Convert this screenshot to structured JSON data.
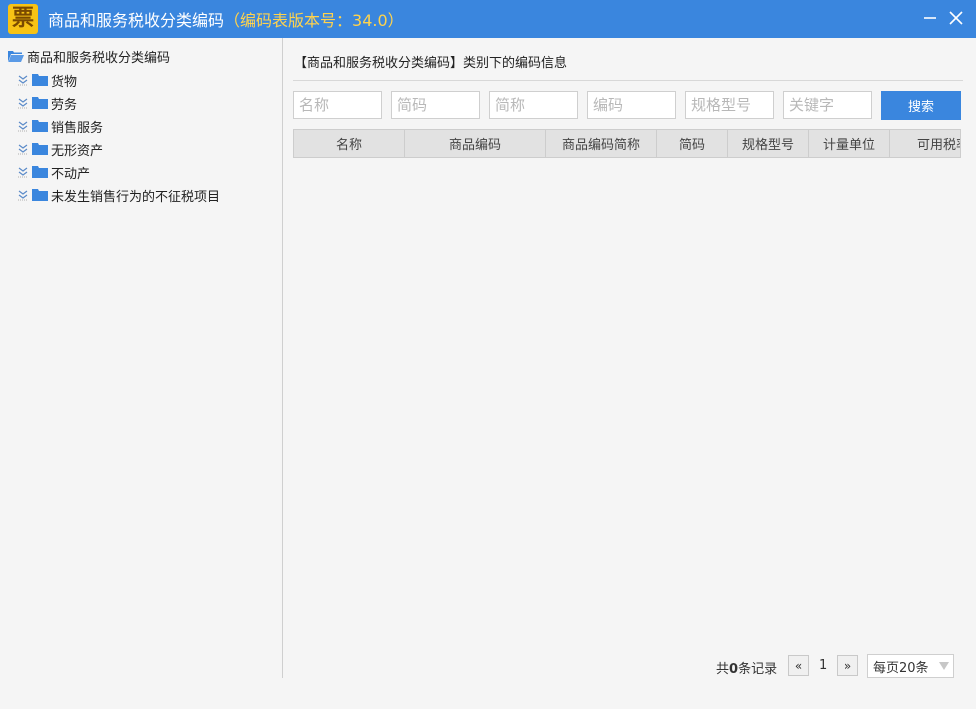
{
  "window": {
    "logo_char": "票",
    "title": "商品和服务税收分类编码",
    "version": "（编码表版本号：34.0）",
    "minimize_icon": "minimize-icon",
    "close_icon": "close-icon"
  },
  "tree": {
    "root_label": "商品和服务税收分类编码",
    "items": [
      {
        "label": "货物"
      },
      {
        "label": "劳务"
      },
      {
        "label": "销售服务"
      },
      {
        "label": "无形资产"
      },
      {
        "label": "不动产"
      },
      {
        "label": "未发生销售行为的不征税项目"
      }
    ]
  },
  "panel": {
    "title": "【商品和服务税收分类编码】类别下的编码信息"
  },
  "filters": {
    "name_placeholder": "名称",
    "code_short_placeholder": "简码",
    "abbr_placeholder": "简称",
    "code_placeholder": "编码",
    "spec_placeholder": "规格型号",
    "keyword_placeholder": "关键字",
    "search_label": "搜索"
  },
  "grid": {
    "columns": [
      "名称",
      "商品编码",
      "商品编码简称",
      "简码",
      "规格型号",
      "计量单位",
      "可用税率"
    ]
  },
  "pager": {
    "total_prefix": "共",
    "total_count": "0",
    "total_suffix": "条记录",
    "prev": "«",
    "page": "1",
    "next": "»",
    "page_size": "每页20条"
  },
  "colors": {
    "accent": "#3a86de",
    "version": "#ffd34d",
    "logo_bg": "#f7c315",
    "folder": "#3a86de"
  }
}
